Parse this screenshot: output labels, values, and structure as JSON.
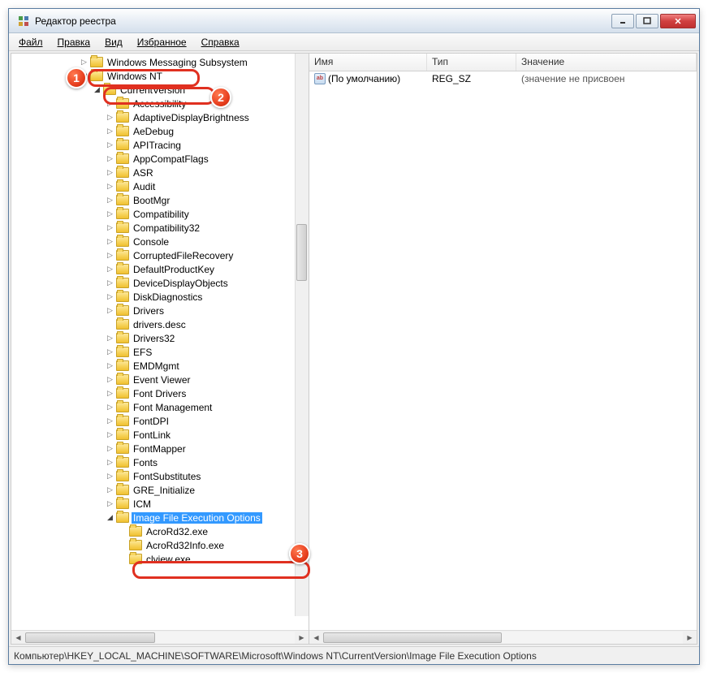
{
  "window": {
    "title": "Редактор реестра"
  },
  "menu": {
    "file": "Файл",
    "edit": "Правка",
    "view": "Вид",
    "favorites": "Избранное",
    "help": "Справка"
  },
  "tree": {
    "top_overflow": "Windows Messaging Subsystem",
    "node1": "Windows NT",
    "node2": "CurrentVersion",
    "children": [
      "Accessibility",
      "AdaptiveDisplayBrightness",
      "AeDebug",
      "APITracing",
      "AppCompatFlags",
      "ASR",
      "Audit",
      "BootMgr",
      "Compatibility",
      "Compatibility32",
      "Console",
      "CorruptedFileRecovery",
      "DefaultProductKey",
      "DeviceDisplayObjects",
      "DiskDiagnostics",
      "Drivers",
      "drivers.desc",
      "Drivers32",
      "EFS",
      "EMDMgmt",
      "Event Viewer",
      "Font Drivers",
      "Font Management",
      "FontDPI",
      "FontLink",
      "FontMapper",
      "Fonts",
      "FontSubstitutes",
      "GRE_Initialize",
      "ICM"
    ],
    "node3": "Image File Execution Options",
    "node3_children": [
      "AcroRd32.exe",
      "AcroRd32Info.exe",
      "clview.exe"
    ]
  },
  "list": {
    "col_name": "Имя",
    "col_type": "Тип",
    "col_value": "Значение",
    "row": {
      "name": "(По умолчанию)",
      "type": "REG_SZ",
      "value": "(значение не присвоен"
    }
  },
  "status": "Компьютер\\HKEY_LOCAL_MACHINE\\SOFTWARE\\Microsoft\\Windows NT\\CurrentVersion\\Image File Execution Options",
  "callouts": {
    "b1": "1",
    "b2": "2",
    "b3": "3"
  }
}
